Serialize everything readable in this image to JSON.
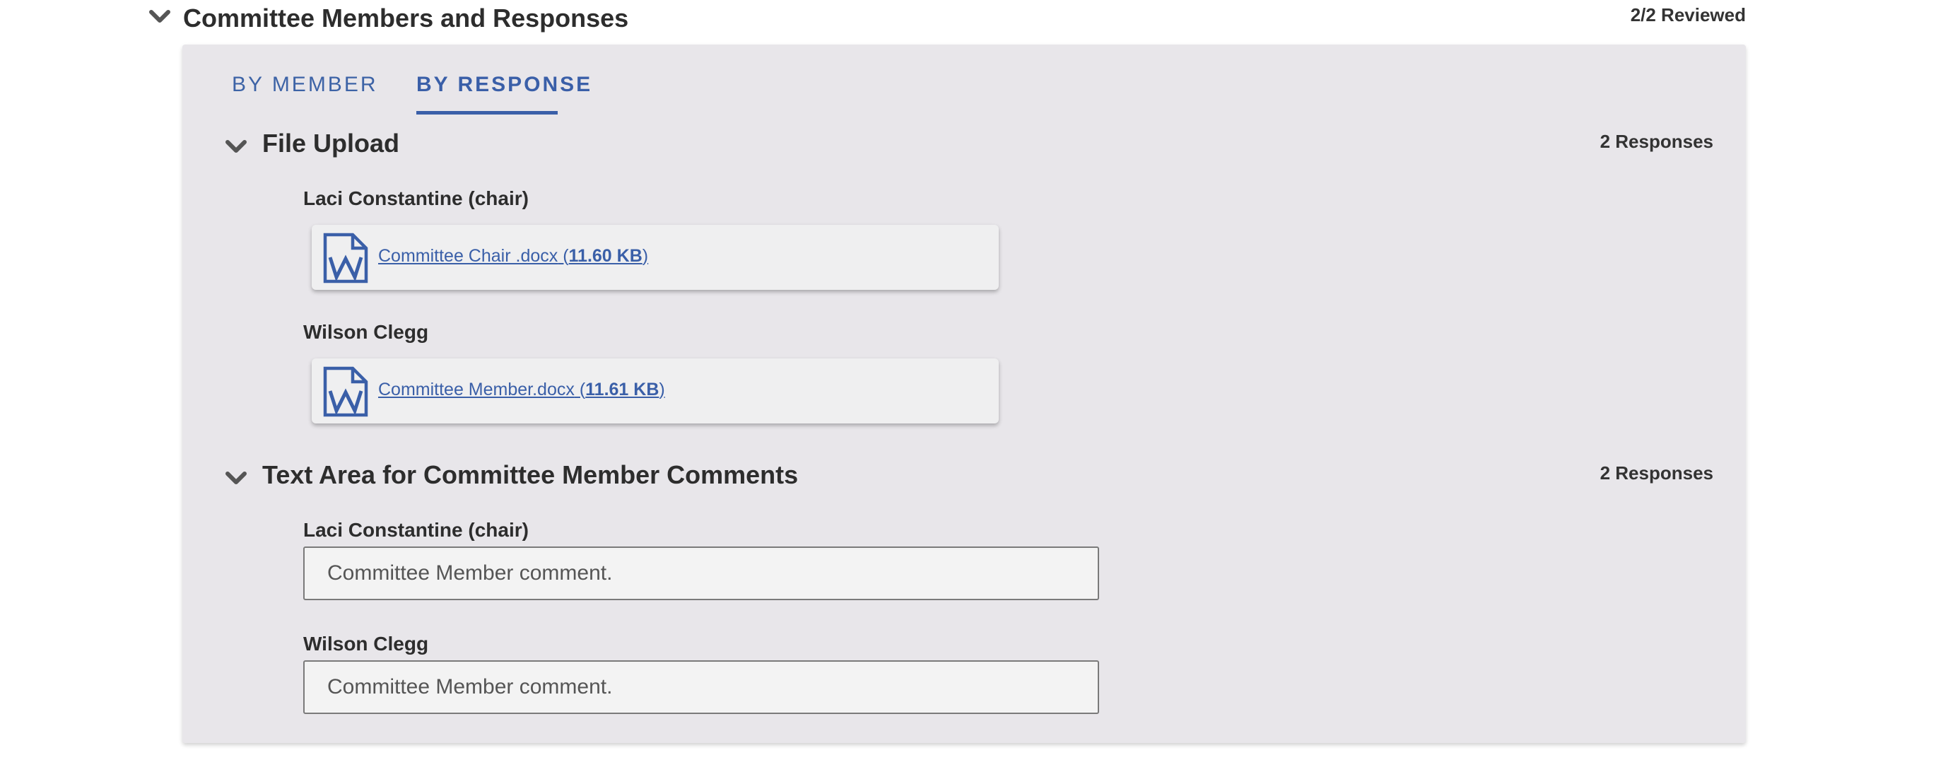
{
  "header": {
    "title": "Committee Members and Responses",
    "reviewed": "2/2 Reviewed"
  },
  "tabs": [
    {
      "label": "BY MEMBER",
      "active": false
    },
    {
      "label": "BY RESPONSE",
      "active": true
    }
  ],
  "sections": [
    {
      "title": "File Upload",
      "count": "2 Responses",
      "responses": [
        {
          "member": "Laci Constantine (chair)",
          "file_name": "Committee Chair .docx",
          "file_size": "11.60 KB",
          "icon": "word-document-icon"
        },
        {
          "member": "Wilson Clegg",
          "file_name": "Committee Member.docx",
          "file_size": "11.61 KB",
          "icon": "word-document-icon"
        }
      ]
    },
    {
      "title": "Text Area for Committee Member Comments",
      "count": "2 Responses",
      "responses": [
        {
          "member": "Laci Constantine (chair)",
          "placeholder": "Committee Member comment."
        },
        {
          "member": "Wilson Clegg",
          "placeholder": "Committee Member comment."
        }
      ]
    }
  ],
  "colors": {
    "accent": "#3a5fa8",
    "panel_bg": "#e8e6ea"
  }
}
